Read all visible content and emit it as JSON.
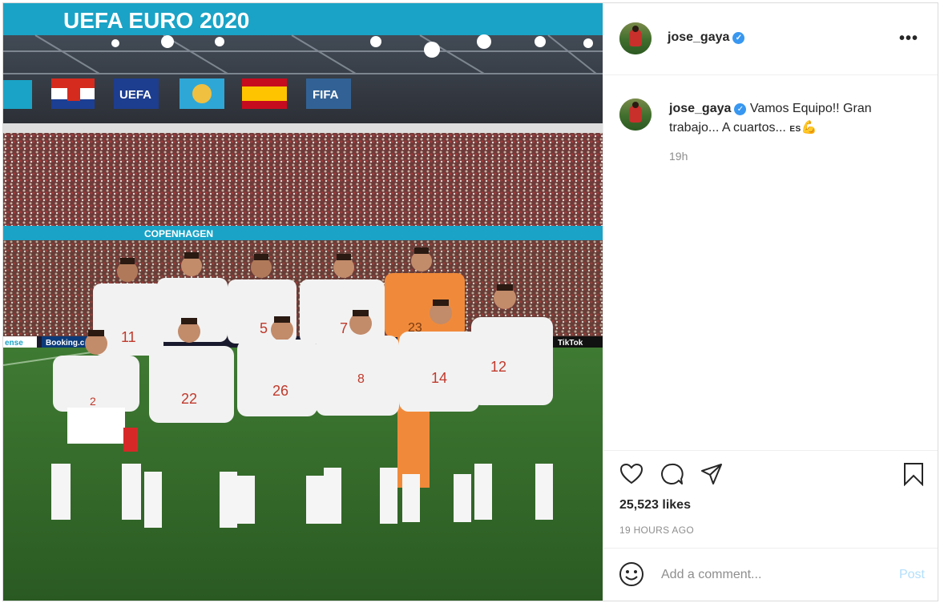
{
  "post": {
    "photo_alt": "Spain national team lineup photo at UEFA EURO 2020, Copenhagen",
    "banner_text": "UEFA EURO 2020",
    "stadium_board": "COPENHAGEN",
    "board_left": "ense",
    "board_booking": "Booking.c",
    "board_tiktok": "TikTok",
    "sponsors": [
      "UEFA",
      "FIFA"
    ],
    "jersey_numbers": [
      "11",
      "5",
      "7",
      "23",
      "2",
      "22",
      "26",
      "8",
      "14",
      "12"
    ]
  },
  "header": {
    "username": "jose_gaya",
    "verified": "✓",
    "more": "•••"
  },
  "caption": {
    "username": "jose_gaya",
    "text": "Vamos Equipo!! Gran trabajo... A cuartos...",
    "flag": "ES",
    "emoji": "💪",
    "time": "19h"
  },
  "actions": {
    "like_icon": "heart-icon",
    "comment_icon": "comment-icon",
    "share_icon": "share-icon",
    "save_icon": "bookmark-icon",
    "likes": "25,523 likes",
    "ago": "19 HOURS AGO"
  },
  "comment": {
    "placeholder": "Add a comment...",
    "post_label": "Post"
  },
  "colors": {
    "accent": "#3897f0",
    "post_disabled": "#b2dffc",
    "text": "#262626",
    "muted": "#8e8e8e"
  }
}
